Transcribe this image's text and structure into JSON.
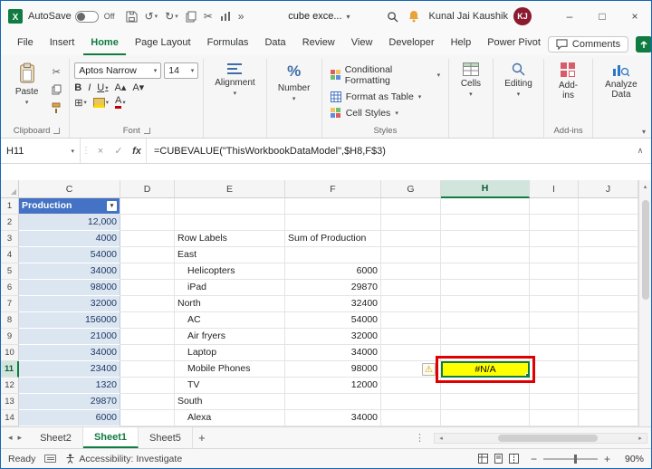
{
  "window": {
    "autosave_label": "AutoSave",
    "autosave_state": "Off",
    "title": "cube exce...",
    "user_name": "Kunal Jai Kaushik",
    "user_initials": "KJ"
  },
  "menu": {
    "items": [
      {
        "label": "File"
      },
      {
        "label": "Insert"
      },
      {
        "label": "Home",
        "active": true
      },
      {
        "label": "Page Layout"
      },
      {
        "label": "Formulas"
      },
      {
        "label": "Data"
      },
      {
        "label": "Review"
      },
      {
        "label": "View"
      },
      {
        "label": "Developer"
      },
      {
        "label": "Help"
      },
      {
        "label": "Power Pivot"
      }
    ],
    "comments_label": "Comments"
  },
  "ribbon": {
    "paste_label": "Paste",
    "clipboard_group_label": "Clipboard",
    "font_name": "Aptos Narrow",
    "font_size": "14",
    "font_group_label": "Font",
    "alignment_label": "Alignment",
    "number_label": "Number",
    "conditional_formatting_label": "Conditional Formatting",
    "format_as_table_label": "Format as Table",
    "cell_styles_label": "Cell Styles",
    "styles_group_label": "Styles",
    "cells_label": "Cells",
    "editing_label": "Editing",
    "addins_label": "Add-ins",
    "addins_group_label": "Add-ins",
    "analyze_data_label": "Analyze Data"
  },
  "formula_bar": {
    "name_box": "H11",
    "fx_label": "fx",
    "formula": "=CUBEVALUE(\"ThisWorkbookDataModel\",$H8,F$3)"
  },
  "grid": {
    "columns": [
      "C",
      "D",
      "E",
      "F",
      "G",
      "H",
      "I",
      "J"
    ],
    "selected_column": "H",
    "selected_row": 11,
    "rows": [
      {
        "n": 1,
        "C": "Production",
        "c_header": true
      },
      {
        "n": 2,
        "C": "12,000"
      },
      {
        "n": 3,
        "C": "4000",
        "E": "Row Labels",
        "F": "Sum of Production"
      },
      {
        "n": 4,
        "C": "54000",
        "E": "East"
      },
      {
        "n": 5,
        "C": "34000",
        "E": "Helicopters",
        "indent": true,
        "F": "6000"
      },
      {
        "n": 6,
        "C": "98000",
        "E": "iPad",
        "indent": true,
        "F": "29870"
      },
      {
        "n": 7,
        "C": "32000",
        "E": "North",
        "F": "32400"
      },
      {
        "n": 8,
        "C": "156000",
        "E": "AC",
        "indent": true,
        "F": "54000"
      },
      {
        "n": 9,
        "C": "21000",
        "E": "Air fryers",
        "indent": true,
        "F": "32000"
      },
      {
        "n": 10,
        "C": "34000",
        "E": "Laptop",
        "indent": true,
        "F": "34000"
      },
      {
        "n": 11,
        "C": "23400",
        "E": "Mobile Phones",
        "indent": true,
        "F": "98000",
        "warning": true,
        "H": "#N/A",
        "selected": true
      },
      {
        "n": 12,
        "C": "1320",
        "E": "TV",
        "indent": true,
        "F": "12000"
      },
      {
        "n": 13,
        "C": "29870",
        "E": "South"
      },
      {
        "n": 14,
        "C": "6000",
        "E": "Alexa",
        "indent": true,
        "F": "34000"
      }
    ]
  },
  "sheet_tabs": {
    "tabs": [
      {
        "label": "Sheet2"
      },
      {
        "label": "Sheet1",
        "active": true
      },
      {
        "label": "Sheet5"
      }
    ],
    "add_label": "+"
  },
  "status_bar": {
    "mode": "Ready",
    "accessibility": "Accessibility: Investigate",
    "zoom": "90%"
  },
  "icons": {
    "dropdown": "▾",
    "undo": "↺",
    "redo": "↻",
    "cut": "✂",
    "border": "⊞",
    "overflow": "»",
    "close": "×",
    "minimize": "–",
    "maximize": "□",
    "check": "✓",
    "cancel": "×",
    "warning": "⚠",
    "ellipsis": "⋮",
    "expand_formula": "∧",
    "bold": "B",
    "italic": "I",
    "underline": "U",
    "grow_font": "A▴",
    "shrink_font": "A▾",
    "font_color": "A",
    "scroll_left": "◂",
    "scroll_right": "▸",
    "scroll_up": "▴",
    "scroll_down": "▾",
    "percent": "%",
    "select_all": "◢"
  },
  "colors": {
    "excel_green": "#107C41",
    "header_blue": "#4472C4",
    "band_blue": "#DCE6F1",
    "selection_yellow": "#FFFF00",
    "annotation_red": "#E00000"
  }
}
